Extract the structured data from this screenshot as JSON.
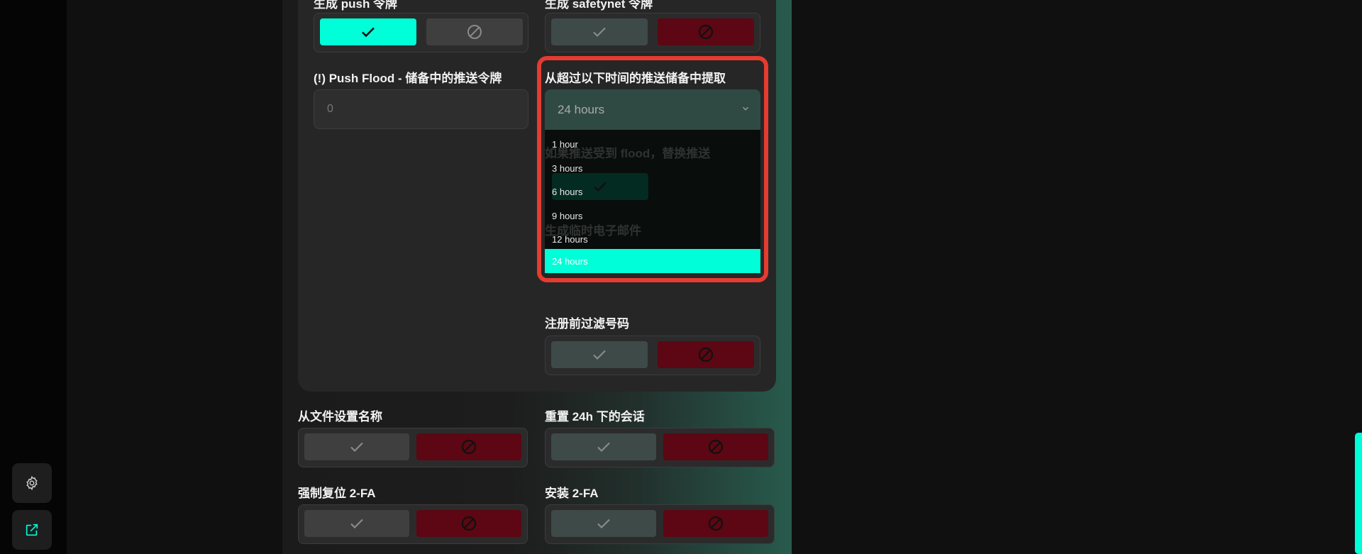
{
  "sidebar": {
    "settings_icon": "gear-icon",
    "external_icon": "external-link-icon"
  },
  "labels": {
    "push_token_top": "生成 push 令牌",
    "safetynet_top": "生成 safetynet 令牌",
    "push_flood": "(!) Push Flood - 储备中的推送令牌",
    "extract_from": "从超过以下时间的推送储备中提取",
    "replace_on_flood": "如果推送受到 flood，替换推送",
    "temp_email": "生成临时电子邮件",
    "filter_numbers": "注册前过滤号码",
    "name_from_file": "从文件设置名称",
    "reset_sessions": "重置 24h 下的会话",
    "force_reset_2fa": "强制复位 2-FA",
    "install_2fa": "安装 2-FA"
  },
  "inputs": {
    "push_flood_value": "0"
  },
  "select": {
    "current_value": "24 hours",
    "options": [
      "1 hour",
      "3 hours",
      "6 hours",
      "9 hours",
      "12 hours",
      "24 hours"
    ],
    "selected_index": 5
  },
  "toggles": {
    "push_token": "yes",
    "safetynet": "no",
    "filter_numbers": "no",
    "name_from_file": "no",
    "reset_sessions": "no",
    "force_reset_2fa": "no",
    "install_2fa": "no"
  },
  "colors": {
    "accent": "#00ffd8",
    "deny": "#5c0713",
    "highlight": "#e53b30"
  }
}
